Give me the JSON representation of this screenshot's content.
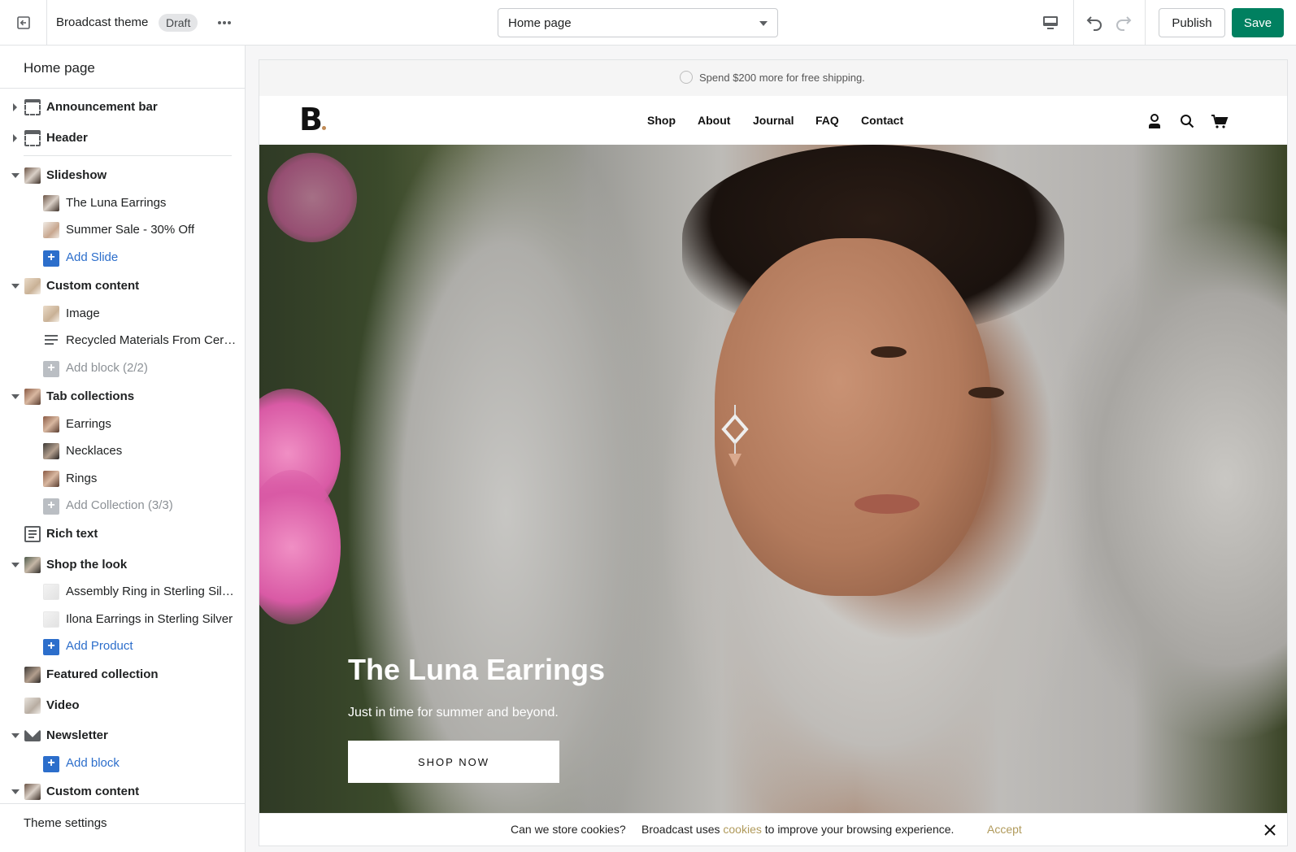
{
  "topbar": {
    "theme_name": "Broadcast theme",
    "status_badge": "Draft",
    "more_icon": "more-horizontal-icon",
    "page_selector": "Home page",
    "publish_label": "Publish",
    "save_label": "Save",
    "accent": "#008060"
  },
  "sidebar": {
    "title": "Home page",
    "items": [
      {
        "label": "Announcement bar"
      },
      {
        "label": "Header"
      },
      {
        "label": "Slideshow"
      },
      {
        "label": "The Luna Earrings"
      },
      {
        "label": "Summer Sale - 30% Off"
      },
      {
        "label": "Add Slide"
      },
      {
        "label": "Custom content"
      },
      {
        "label": "Image"
      },
      {
        "label": "Recycled Materials From Certif..."
      },
      {
        "label": "Add block (2/2)"
      },
      {
        "label": "Tab collections"
      },
      {
        "label": "Earrings"
      },
      {
        "label": "Necklaces"
      },
      {
        "label": "Rings"
      },
      {
        "label": "Add Collection (3/3)"
      },
      {
        "label": "Rich text"
      },
      {
        "label": "Shop the look"
      },
      {
        "label": "Assembly Ring in Sterling Silver"
      },
      {
        "label": "Ilona Earrings in Sterling Silver"
      },
      {
        "label": "Add Product"
      },
      {
        "label": "Featured collection"
      },
      {
        "label": "Video"
      },
      {
        "label": "Newsletter"
      },
      {
        "label": "Add block"
      },
      {
        "label": "Custom content"
      }
    ],
    "theme_settings": "Theme settings",
    "link_color": "#2c6ecb"
  },
  "preview": {
    "announcement": "Spend $200 more for free shipping.",
    "logo": "B",
    "nav": [
      "Shop",
      "About",
      "Journal",
      "FAQ",
      "Contact"
    ],
    "hero": {
      "title": "The Luna Earrings",
      "subtitle": "Just in time for summer and beyond.",
      "cta": "SHOP NOW"
    },
    "cookie": {
      "question": "Can we store cookies?",
      "message_before": "Broadcast uses ",
      "link": "cookies",
      "message_after": " to improve your browsing experience.",
      "accept": "Accept"
    }
  }
}
